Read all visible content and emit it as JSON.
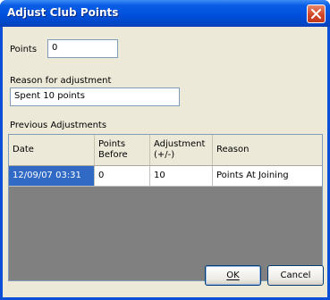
{
  "window": {
    "title": "Adjust Club Points"
  },
  "form": {
    "points_label": "Points",
    "points_value": "0",
    "reason_label": "Reason for adjustment",
    "reason_value": "Spent 10 points",
    "previous_label": "Previous Adjustments"
  },
  "table": {
    "columns": [
      "Date",
      "Points\nBefore",
      "Adjustment\n(+/-)",
      "Reason"
    ],
    "rows": [
      [
        "12/09/07 03:31",
        "0",
        "10",
        "Points At Joining"
      ]
    ]
  },
  "buttons": {
    "ok": "OK",
    "cancel": "Cancel"
  },
  "colors": {
    "title_bar": "#0050dc",
    "selection": "#316ac5",
    "grid_bg": "#808080",
    "client_bg": "#ece9d8"
  },
  "icons": {
    "close": "close-icon"
  }
}
